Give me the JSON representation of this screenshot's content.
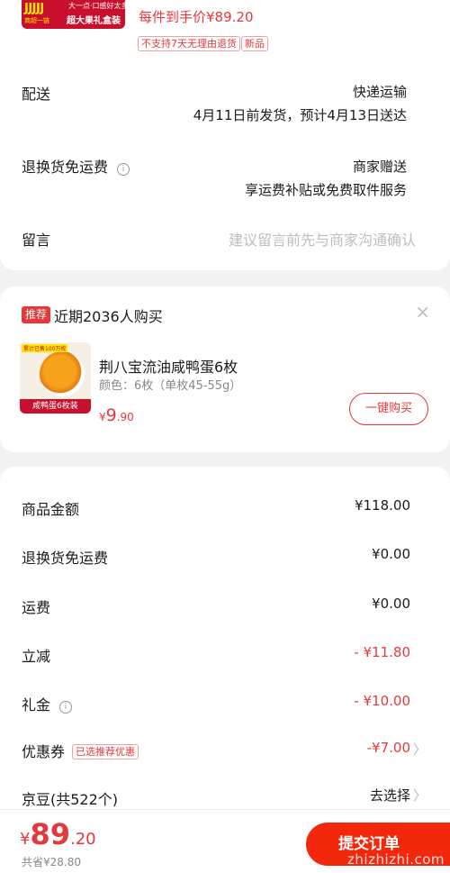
{
  "top_product": {
    "thumb_brand": "JJJJJ",
    "thumb_line1": "大一点·口感好太多",
    "thumb_line2": "超大果礼盒装",
    "thumb_line3": "商超一链",
    "price_each": "每件到手价¥89.20",
    "tags": [
      "不支持7天无理由退货",
      "新品"
    ]
  },
  "delivery": {
    "label": "配送",
    "method": "快递运输",
    "schedule": "4月11日前发货，预计4月13日送达"
  },
  "return_shipping": {
    "label": "退换货免运费",
    "line1": "商家赠送",
    "line2": "享运费补贴或免费取件服务"
  },
  "message": {
    "label": "留言",
    "placeholder": "建议留言前先与商家沟通确认"
  },
  "recommend": {
    "badge": "推荐",
    "title": "近期2036人购买",
    "close": "×",
    "image_top_tag": "累计已售100万枚",
    "image_ribbon": "咸鸭蛋6枚装",
    "name": "荆八宝流油咸鸭蛋6枚",
    "spec": "颜色：6枚（单枚45-55g）",
    "price_symbol": "¥",
    "price_int": "9",
    "price_dec": ".90",
    "buy_button": "一键购买"
  },
  "summary": {
    "rows": [
      {
        "label": "商品金额",
        "value": "¥118.00"
      },
      {
        "label": "退换货免运费",
        "value": "¥0.00"
      },
      {
        "label": "运费",
        "value": "¥0.00"
      },
      {
        "label": "立减",
        "value": "- ¥11.80"
      },
      {
        "label": "礼金",
        "value": "- ¥10.00"
      },
      {
        "label": "优惠券",
        "value": "-¥7.00",
        "tag": "已选推荐优惠"
      },
      {
        "label": "京豆(共522个)",
        "value": "去选择"
      }
    ]
  },
  "bottom": {
    "total_symbol": "¥",
    "total_int": "89",
    "total_dec": ".20",
    "saved": "共省¥28.80",
    "submit": "提交订单",
    "watermark": "zhizhizhi.com"
  },
  "colors": {
    "accent": "#e4393c",
    "submit": "#f2270c"
  }
}
